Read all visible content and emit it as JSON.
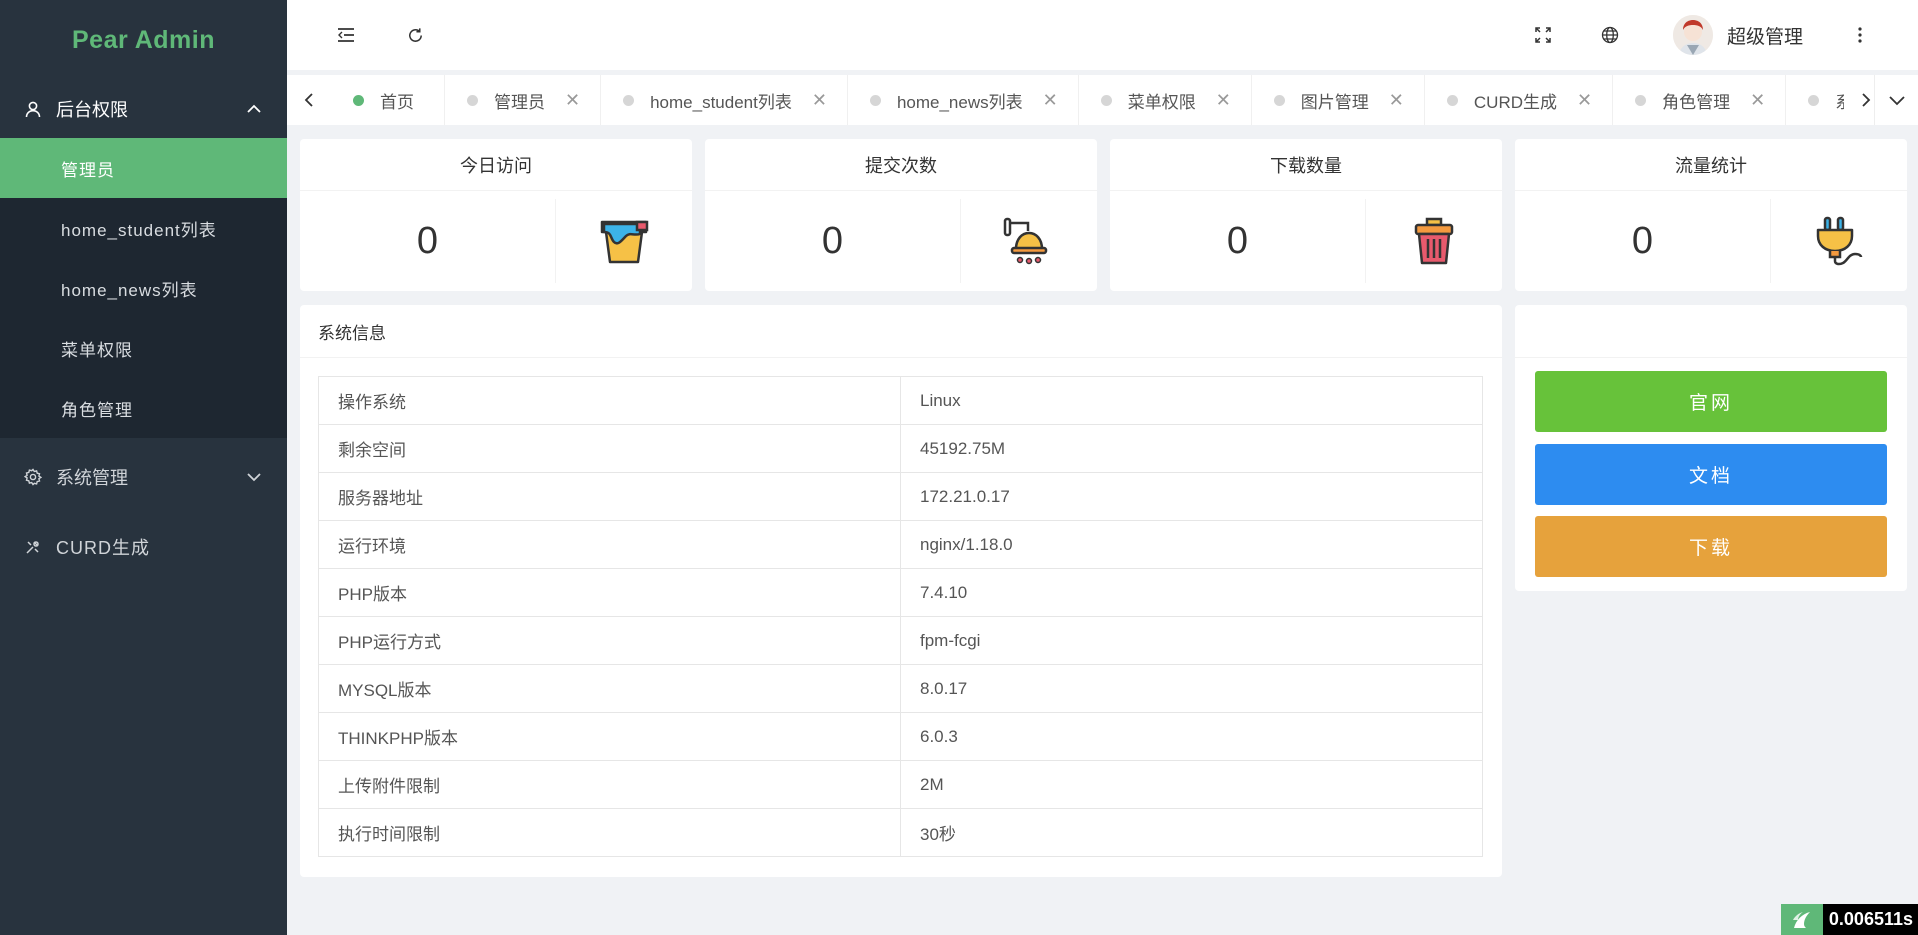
{
  "app": {
    "title": "Pear Admin"
  },
  "sidebar": {
    "groups": [
      {
        "label": "后台权限",
        "icon": "user-icon",
        "expanded": true,
        "items": [
          {
            "label": "管理员",
            "active": true
          },
          {
            "label": "home_student列表"
          },
          {
            "label": "home_news列表"
          },
          {
            "label": "菜单权限"
          },
          {
            "label": "角色管理"
          }
        ]
      },
      {
        "label": "系统管理",
        "icon": "gear-icon",
        "expanded": false
      },
      {
        "label": "CURD生成",
        "icon": "tools-icon"
      }
    ]
  },
  "header": {
    "icons": [
      "menu-collapse-icon",
      "refresh-icon",
      "fullscreen-icon",
      "globe-icon",
      "more-vertical-icon"
    ],
    "user": {
      "name": "超级管理"
    }
  },
  "tabs": [
    {
      "label": "首页",
      "active": true,
      "closable": false
    },
    {
      "label": "管理员",
      "closable": true
    },
    {
      "label": "home_student列表",
      "closable": true
    },
    {
      "label": "home_news列表",
      "closable": true
    },
    {
      "label": "菜单权限",
      "closable": true
    },
    {
      "label": "图片管理",
      "closable": true
    },
    {
      "label": "CURD生成",
      "closable": true
    },
    {
      "label": "角色管理",
      "closable": true
    },
    {
      "label": "系统管理",
      "closable": true
    }
  ],
  "stats": [
    {
      "title": "今日访问",
      "value": "0",
      "icon": "paint-bucket-icon"
    },
    {
      "title": "提交次数",
      "value": "0",
      "icon": "shower-icon"
    },
    {
      "title": "下载数量",
      "value": "0",
      "icon": "trash-bin-icon"
    },
    {
      "title": "流量统计",
      "value": "0",
      "icon": "plug-icon"
    }
  ],
  "system_info": {
    "title": "系统信息",
    "rows": [
      {
        "key": "操作系统",
        "value": "Linux"
      },
      {
        "key": "剩余空间",
        "value": "45192.75M"
      },
      {
        "key": "服务器地址",
        "value": "172.21.0.17"
      },
      {
        "key": "运行环境",
        "value": "nginx/1.18.0"
      },
      {
        "key": "PHP版本",
        "value": "7.4.10"
      },
      {
        "key": "PHP运行方式",
        "value": "fpm-fcgi"
      },
      {
        "key": "MYSQL版本",
        "value": "8.0.17"
      },
      {
        "key": "THINKPHP版本",
        "value": "6.0.3"
      },
      {
        "key": "上传附件限制",
        "value": "2M"
      },
      {
        "key": "执行时间限制",
        "value": "30秒"
      }
    ]
  },
  "links": [
    {
      "label": "官网",
      "color": "#67c23a"
    },
    {
      "label": "文档",
      "color": "#2d8cf0"
    },
    {
      "label": "下载",
      "color": "#e6a23c"
    }
  ],
  "timer": {
    "value": "0.006511s"
  },
  "colors": {
    "sidebar": "#28333e",
    "submenu": "#1e2731",
    "accent": "#5fb878",
    "background": "#f0f2f5"
  }
}
